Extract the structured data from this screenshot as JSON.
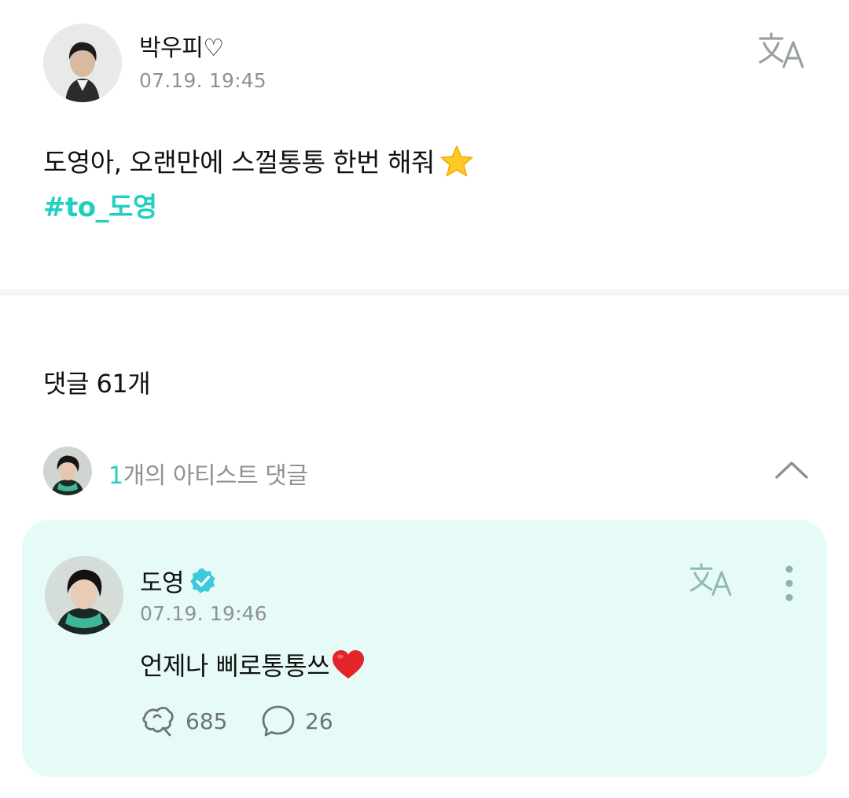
{
  "post": {
    "author": "박우피♡",
    "timestamp": "07.19. 19:45",
    "text": "도영아, 오랜만에 스껄통통 한번 해줘",
    "text_emoji": "star",
    "hashtag": "#to_도영",
    "translate_icon": "translate-icon"
  },
  "comments": {
    "count_label": "댓글 61개",
    "artist_summary": {
      "count": "1",
      "label": "개의 아티스트 댓글",
      "toggle_icon": "chevron-up-icon"
    },
    "artist_comment": {
      "author": "도영",
      "verified_icon": "verified-badge-icon",
      "timestamp": "07.19. 19:46",
      "text": "언제나 삐로통통쓰",
      "text_emoji": "heart",
      "likes": "685",
      "replies": "26",
      "background_color": "#e6faf7",
      "accent_color": "#1fcfc0"
    }
  }
}
